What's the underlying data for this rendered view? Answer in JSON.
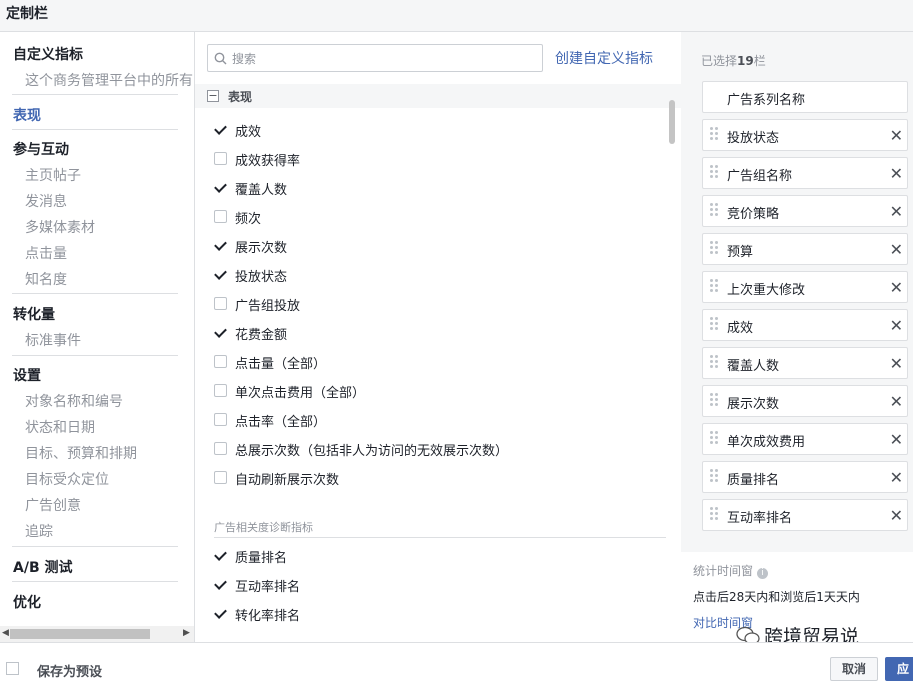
{
  "dialog": {
    "title": "定制栏"
  },
  "left_nav": {
    "custom_metrics_title": "自定义指标",
    "custom_metrics_desc": "这个商务管理平台中的所有",
    "performance": "表现",
    "engagement": {
      "title": "参与互动",
      "items": [
        "主页帖子",
        "发消息",
        "多媒体素材",
        "点击量",
        "知名度"
      ]
    },
    "conversions": {
      "title": "转化量",
      "items": [
        "标准事件"
      ]
    },
    "settings": {
      "title": "设置",
      "items": [
        "对象名称和编号",
        "状态和日期",
        "目标、预算和排期",
        "目标受众定位",
        "广告创意",
        "追踪"
      ]
    },
    "ab_test": "A/B 测试",
    "optimization": "优化"
  },
  "middle": {
    "search_placeholder": "搜索",
    "create_custom_metric": "创建自定义指标",
    "group_label": "表现",
    "items": [
      {
        "label": "成效",
        "checked": true
      },
      {
        "label": "成效获得率",
        "checked": false
      },
      {
        "label": "覆盖人数",
        "checked": true
      },
      {
        "label": "频次",
        "checked": false
      },
      {
        "label": "展示次数",
        "checked": true
      },
      {
        "label": "投放状态",
        "checked": true
      },
      {
        "label": "广告组投放",
        "checked": false
      },
      {
        "label": "花费金额",
        "checked": true
      },
      {
        "label": "点击量（全部）",
        "checked": false
      },
      {
        "label": "单次点击费用（全部）",
        "checked": false
      },
      {
        "label": "点击率（全部）",
        "checked": false
      },
      {
        "label": "总展示次数（包括非人为访问的无效展示次数）",
        "checked": false
      },
      {
        "label": "自动刷新展示次数",
        "checked": false
      }
    ],
    "diagnostics_heading": "广告相关度诊断指标",
    "diagnostics_items": [
      {
        "label": "质量排名",
        "checked": true
      },
      {
        "label": "互动率排名",
        "checked": true
      },
      {
        "label": "转化率排名",
        "checked": true
      }
    ]
  },
  "right": {
    "selected_prefix": "已选择",
    "selected_count": "19",
    "selected_suffix": "栏",
    "columns": [
      "广告系列名称",
      "投放状态",
      "广告组名称",
      "竞价策略",
      "预算",
      "上次重大修改",
      "成效",
      "覆盖人数",
      "展示次数",
      "单次成效费用",
      "质量排名",
      "互动率排名"
    ],
    "attribution_title": "统计时间窗",
    "attribution_value": "点击后28天内和浏览后1天天内",
    "compare_link": "对比时间窗",
    "watermark": "跨境贸易说"
  },
  "footer": {
    "save_preset": "保存为预设",
    "cancel": "取消",
    "apply": "应"
  }
}
